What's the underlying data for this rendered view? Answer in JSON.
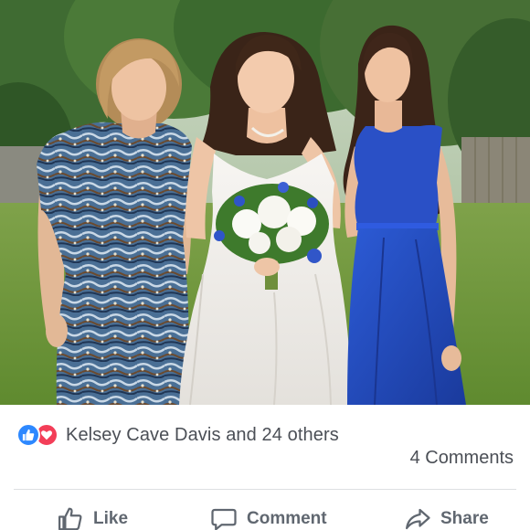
{
  "post": {
    "photo_alt": "",
    "reactions": {
      "icons": [
        "like-icon",
        "love-icon"
      ],
      "summary": "Kelsey Cave Davis and 24 others"
    },
    "comments_count": "4 Comments"
  },
  "actions": {
    "like_label": "Like",
    "comment_label": "Comment",
    "share_label": "Share"
  },
  "colors": {
    "like_blue": "#2d88ff",
    "love_red": "#f33e58",
    "text_gray": "#4b4f56",
    "divider": "#dddfe2"
  }
}
